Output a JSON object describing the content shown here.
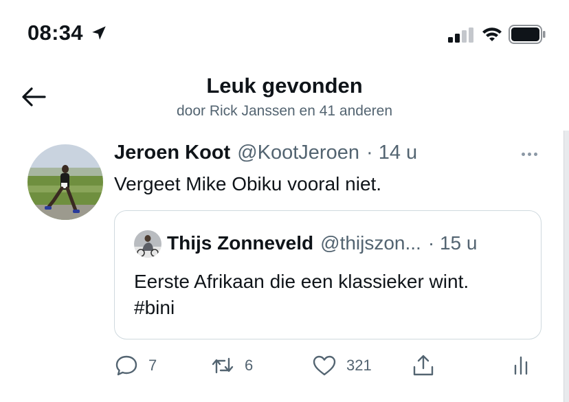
{
  "status_bar": {
    "time": "08:34",
    "location_icon": "location-arrow-icon",
    "signal_icon": "cellular-signal-icon",
    "wifi_icon": "wifi-icon",
    "battery_icon": "battery-icon"
  },
  "header": {
    "back_icon": "arrow-left-icon",
    "title": "Leuk gevonden",
    "subtitle": "door Rick Janssen en 41 anderen"
  },
  "tweet": {
    "author_name": "Jeroen Koot",
    "author_handle": "@KootJeroen",
    "separator": "·",
    "time": "14 u",
    "more_icon": "more-dots-icon",
    "text": "Vergeet Mike Obiku vooral niet.",
    "quoted": {
      "author_name": "Thijs Zonneveld",
      "author_handle": "@thijszon...",
      "separator": "·",
      "time": "15 u",
      "text_line1": "Eerste Afrikaan die een klassieker wint.",
      "text_line2": "#bini"
    },
    "actions": {
      "replies": "7",
      "retweets": "6",
      "likes": "321"
    }
  },
  "colors": {
    "text": "#0f1419",
    "secondary": "#536471",
    "border": "#cfd9de"
  }
}
